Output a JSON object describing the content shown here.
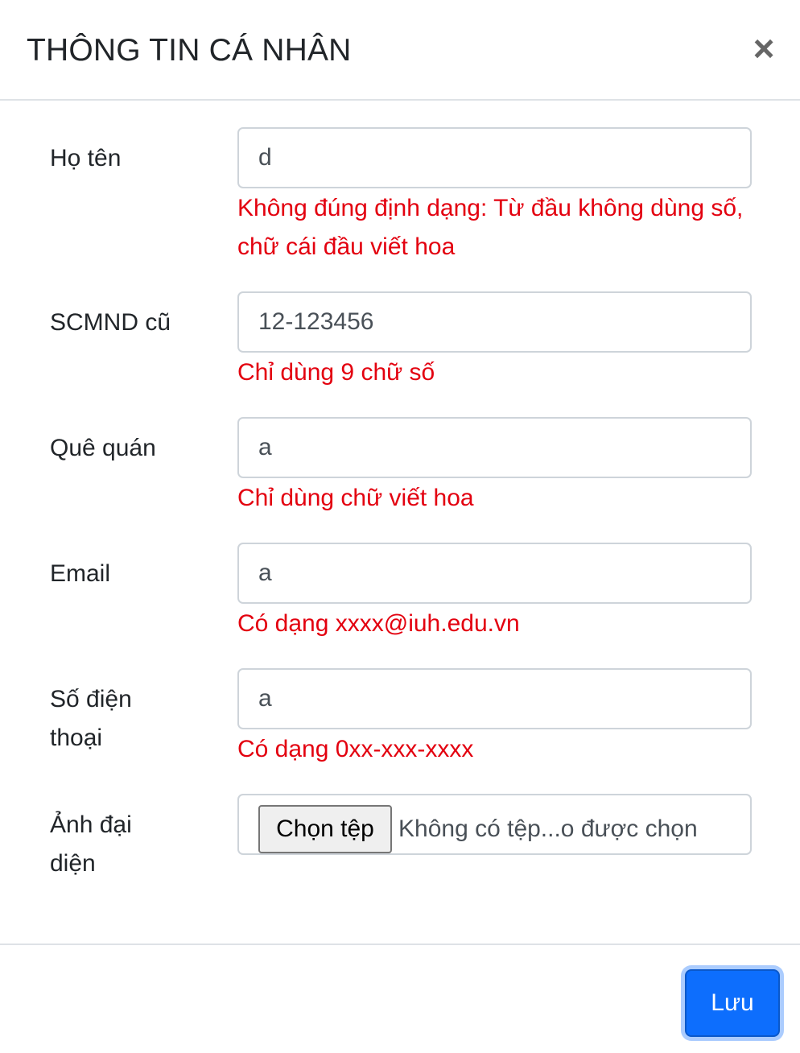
{
  "header": {
    "title": "THÔNG TIN CÁ NHÂN",
    "close_glyph": "×"
  },
  "fields": [
    {
      "label": "Họ tên",
      "value": "d",
      "error": "Không đúng định dạng: Từ đầu không dùng số, chữ cái đầu viết hoa"
    },
    {
      "label": "SCMND cũ",
      "value": "12-123456",
      "error": "Chỉ dùng 9 chữ số"
    },
    {
      "label": "Quê quán",
      "value": "a",
      "error": "Chỉ dùng chữ viết hoa"
    },
    {
      "label": "Email",
      "value": "a",
      "error": "Có dạng xxxx@iuh.edu.vn"
    },
    {
      "label": "Số điện thoại",
      "value": "a",
      "error": "Có dạng 0xx-xxx-xxxx"
    }
  ],
  "avatar": {
    "label": "Ảnh đại diện",
    "button_label": "Chọn tệp",
    "file_status": "Không có tệp...o được chọn"
  },
  "footer": {
    "save_label": "Lưu"
  },
  "colors": {
    "error": "#e3000f",
    "primary": "#0d6efd",
    "border": "#ced4da"
  }
}
